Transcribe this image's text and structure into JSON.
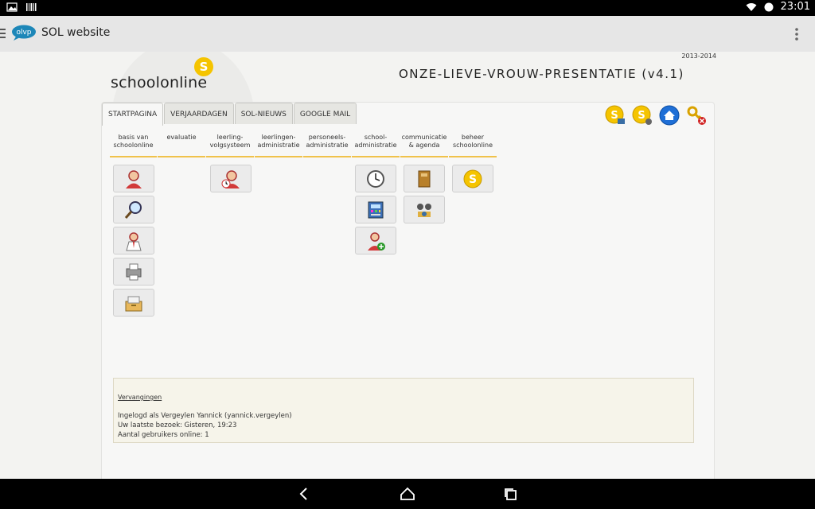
{
  "status_bar": {
    "time": "23:01"
  },
  "app_bar": {
    "logo_text": "olvp",
    "title": "SOL website"
  },
  "header": {
    "school_year": "2013-2014",
    "brand": "schoolonline",
    "school_name": "ONZE-LIEVE-VROUW-PRESENTATIE (v4.1)"
  },
  "tabs": [
    {
      "label": "STARTPAGINA",
      "active": true
    },
    {
      "label": "VERJAARDAGEN",
      "active": false
    },
    {
      "label": "SOL-NIEUWS",
      "active": false
    },
    {
      "label": "GOOGLE MAIL",
      "active": false
    }
  ],
  "columns": [
    {
      "line1": "basis van",
      "line2": "schoolonline"
    },
    {
      "line1": "evaluatie",
      "line2": ""
    },
    {
      "line1": "leerling-",
      "line2": "volgsysteem"
    },
    {
      "line1": "leerlingen-",
      "line2": "administratie"
    },
    {
      "line1": "personeels-",
      "line2": "administratie"
    },
    {
      "line1": "school-",
      "line2": "administratie"
    },
    {
      "line1": "communicatie",
      "line2": "& agenda"
    },
    {
      "line1": "beheer",
      "line2": "schoolonline"
    }
  ],
  "info": {
    "link": "Vervangingen",
    "logged_in": "Ingelogd als Vergeylen Yannick (yannick.vergeylen)",
    "last_visit": "Uw laatste bezoek: Gisteren, 19:23",
    "online": "Aantal gebruikers online: 1"
  },
  "colors": {
    "accent_yellow": "#f5c400",
    "tab_underline": "#f0c24a",
    "home_blue": "#1f6fd6"
  }
}
